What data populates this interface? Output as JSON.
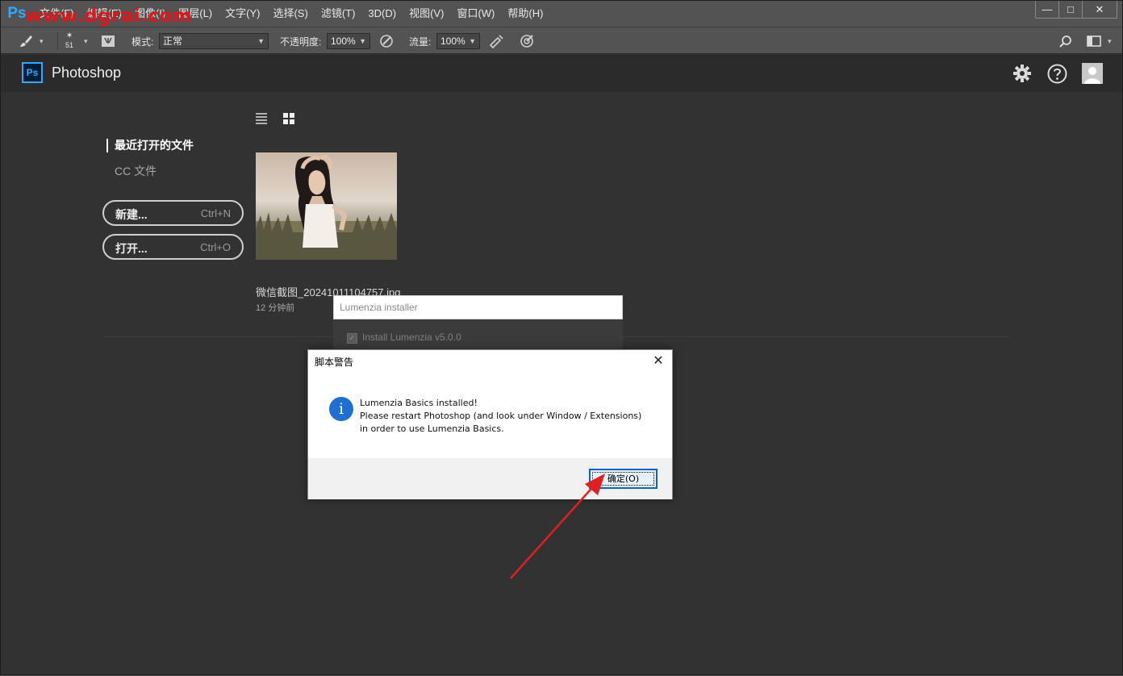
{
  "app": {
    "logo": "Ps",
    "watermark": "www.dgrai.com"
  },
  "menu": [
    "文件(F)",
    "编辑(E)",
    "图像(I)",
    "图层(L)",
    "文字(Y)",
    "选择(S)",
    "滤镜(T)",
    "3D(D)",
    "视图(V)",
    "窗口(W)",
    "帮助(H)"
  ],
  "window_controls": {
    "minimize": "—",
    "restore": "□",
    "close": "✕"
  },
  "options": {
    "brush_size": "51",
    "mode_label": "模式:",
    "mode_value": "正常",
    "opacity_label": "不透明度:",
    "opacity_value": "100%",
    "flow_label": "流量:",
    "flow_value": "100%"
  },
  "header": {
    "badge": "Ps",
    "title": "Photoshop"
  },
  "home": {
    "nav_recent": "最近打开的文件",
    "nav_cc": "CC 文件",
    "new_button": "新建...",
    "new_shortcut": "Ctrl+N",
    "open_button": "打开...",
    "open_shortcut": "Ctrl+O",
    "recent_file": {
      "name": "微信截图_20241011104757.jpg",
      "time": "12 分钟前"
    }
  },
  "lumenzia": {
    "title": "Lumenzia installer",
    "install_label": "Install Lumenzia v5.0.0"
  },
  "dialog": {
    "title": "脚本警告",
    "close": "✕",
    "icon": "i",
    "line1": "Lumenzia Basics installed!",
    "line2": "Please restart Photoshop (and look under Window / Extensions) in order to use Lumenzia Basics.",
    "ok": "确定(O)"
  },
  "colors": {
    "accent": "#31a8ff",
    "arrow": "#e02020",
    "focus": "#0a63c8"
  }
}
